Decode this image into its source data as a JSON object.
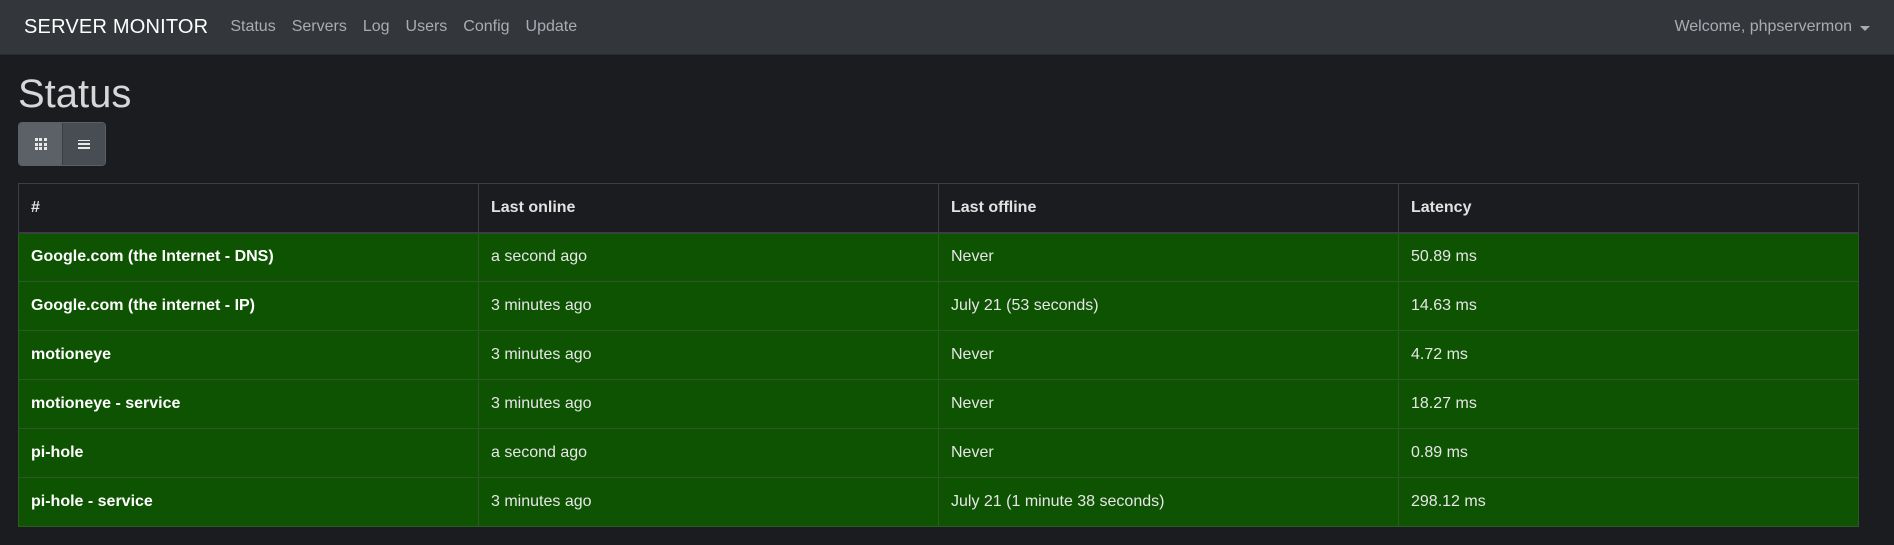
{
  "navbar": {
    "brand": "SERVER MONITOR",
    "links": [
      "Status",
      "Servers",
      "Log",
      "Users",
      "Config",
      "Update"
    ],
    "welcome": "Welcome, phpservermon"
  },
  "page": {
    "title": "Status"
  },
  "view_toggle": {
    "active": "grid",
    "icons": [
      "grid-icon",
      "list-icon"
    ]
  },
  "table": {
    "headers": [
      "#",
      "Last online",
      "Last offline",
      "Latency"
    ],
    "rows": [
      [
        "Google.com (the Internet - DNS)",
        "a second ago",
        "Never",
        "50.89 ms"
      ],
      [
        "Google.com (the internet - IP)",
        "3 minutes ago",
        "July 21 (53 seconds)",
        "14.63 ms"
      ],
      [
        "motioneye",
        "3 minutes ago",
        "Never",
        "4.72 ms"
      ],
      [
        "motioneye - service",
        "3 minutes ago",
        "Never",
        "18.27 ms"
      ],
      [
        "pi-hole",
        "a second ago",
        "Never",
        "0.89 ms"
      ],
      [
        "pi-hole - service",
        "3 minutes ago",
        "July 21 (1 minute 38 seconds)",
        "298.12 ms"
      ]
    ]
  },
  "colors": {
    "navbar_bg": "#33373b",
    "page_bg": "#1b1c1f",
    "row_online_bg": "#0d5302"
  }
}
